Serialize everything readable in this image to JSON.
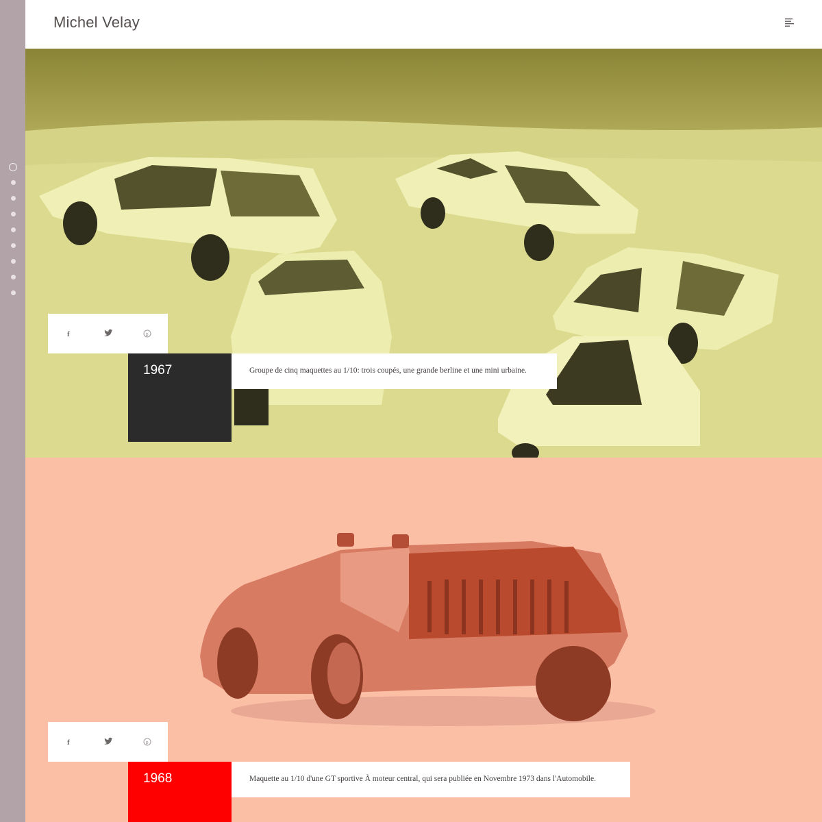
{
  "brand": "Michel Velay",
  "header": {
    "menu_icon": "menu-lines-icon"
  },
  "side_nav": {
    "dot_count": 9,
    "active_index": 0
  },
  "colors": {
    "rail": "#b2a3a9",
    "section1_tint": "#e6e49a",
    "section2_tint": "#fbbfa6",
    "year1_box": "#2b2b2b",
    "year2_box": "#ff0000"
  },
  "share_icons": [
    "facebook-icon",
    "twitter-icon",
    "pinterest-icon"
  ],
  "entries": [
    {
      "year": "1967",
      "caption": "Groupe de cinq maquettes au 1/10: trois coupés, une grande berline et une mini urbaine."
    },
    {
      "year": "1968",
      "caption": "Maquette au 1/10 d'une GT sportive Ã  moteur central, qui sera publiée en Novembre 1973 dans l'Automobile."
    }
  ]
}
